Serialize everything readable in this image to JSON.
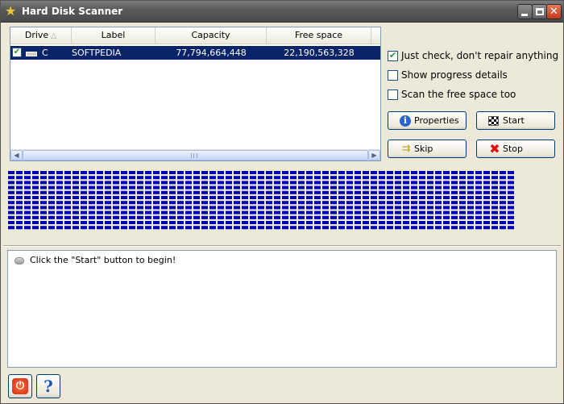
{
  "window": {
    "title": "Hard Disk Scanner",
    "icon": "star-icon",
    "controls": [
      "minimize",
      "maximize",
      "close"
    ]
  },
  "drive_list": {
    "columns": [
      "Drive",
      "Label",
      "Capacity",
      "Free space"
    ],
    "sort_column": "Drive",
    "rows": [
      {
        "checked": true,
        "drive": "C",
        "label": "SOFTPEDIA",
        "capacity": "77,794,664,448",
        "free_space": "22,190,563,328",
        "selected": true
      }
    ]
  },
  "options": {
    "just_check": {
      "label": "Just check, don't repair anything",
      "checked": true
    },
    "show_progress": {
      "label": "Show progress details",
      "checked": false
    },
    "scan_free_space": {
      "label": "Scan the free space too",
      "checked": false
    }
  },
  "buttons": {
    "properties": "Properties",
    "start": "Start",
    "skip": "Skip",
    "stop": "Stop"
  },
  "block_map": {
    "rows": 12,
    "cols": 63,
    "color": "#0000b4"
  },
  "log": {
    "lines": [
      "Click the \"Start\" button to begin!"
    ]
  },
  "colors": {
    "selection": "#0a246a",
    "block": "#0000b4",
    "stop_icon": "#e01010",
    "check_icon": "#21a121"
  }
}
